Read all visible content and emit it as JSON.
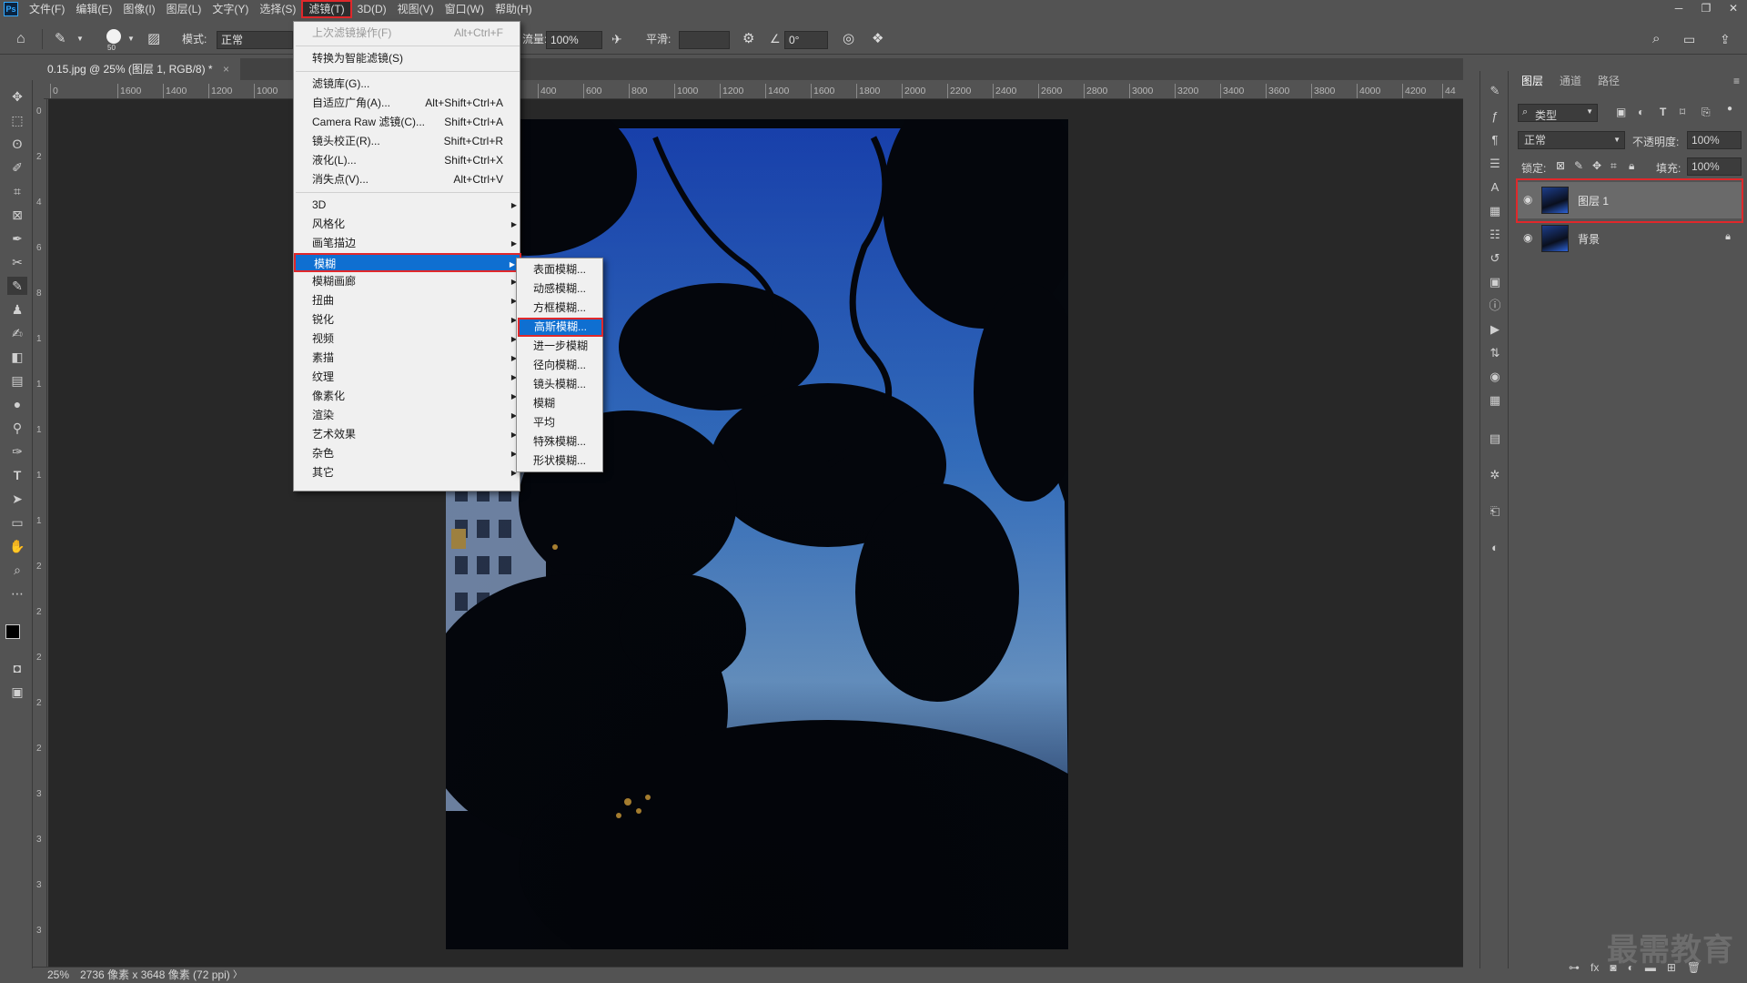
{
  "app": {
    "logo": "Ps"
  },
  "menubar": {
    "items": [
      "文件(F)",
      "编辑(E)",
      "图像(I)",
      "图层(L)",
      "文字(Y)",
      "选择(S)",
      "滤镜(T)",
      "3D(D)",
      "视图(V)",
      "窗口(W)",
      "帮助(H)"
    ],
    "active_index": 6
  },
  "window_controls": {
    "minimize": "─",
    "restore": "❐",
    "close": "✕"
  },
  "options_bar": {
    "brush_size": "50",
    "mode_label": "模式:",
    "mode_value": "正常",
    "flow_label": "流量:",
    "flow_value": "100%",
    "smoothing_label": "平滑:",
    "smoothing_value": "",
    "angle_value": "0°"
  },
  "document_tab": {
    "title": "0.15.jpg @ 25% (图层 1, RGB/8) *",
    "close": "×"
  },
  "ruler_top": [
    "0",
    "1600",
    "1400",
    "1200",
    "1000",
    "800",
    "400",
    "600",
    "800",
    "1000",
    "1200",
    "1400",
    "1600",
    "1800",
    "2000",
    "2200",
    "2400",
    "2600",
    "2800",
    "3000",
    "3200",
    "3400",
    "3600",
    "3800",
    "4000",
    "4200",
    "44"
  ],
  "ruler_left": [
    "0",
    "2",
    "4",
    "6",
    "8",
    "1",
    "1",
    "1",
    "1",
    "1",
    "2",
    "2",
    "2",
    "2",
    "2",
    "3",
    "3",
    "3",
    "3"
  ],
  "filter_menu": {
    "items": [
      {
        "label": "上次滤镜操作(F)",
        "shortcut": "Alt+Ctrl+F",
        "disabled": true
      },
      {
        "sep": true
      },
      {
        "label": "转换为智能滤镜(S)",
        "shortcut": ""
      },
      {
        "sep": true
      },
      {
        "label": "滤镜库(G)...",
        "shortcut": ""
      },
      {
        "label": "自适应广角(A)...",
        "shortcut": "Alt+Shift+Ctrl+A"
      },
      {
        "label": "Camera Raw 滤镜(C)...",
        "shortcut": "Shift+Ctrl+A"
      },
      {
        "label": "镜头校正(R)...",
        "shortcut": "Shift+Ctrl+R"
      },
      {
        "label": "液化(L)...",
        "shortcut": "Shift+Ctrl+X"
      },
      {
        "label": "消失点(V)...",
        "shortcut": "Alt+Ctrl+V"
      },
      {
        "sep": true
      },
      {
        "label": "3D",
        "submenu": true
      },
      {
        "label": "风格化",
        "submenu": true
      },
      {
        "label": "画笔描边",
        "submenu": true
      },
      {
        "label": "模糊",
        "submenu": true,
        "highlighted": true
      },
      {
        "label": "模糊画廊",
        "submenu": true
      },
      {
        "label": "扭曲",
        "submenu": true
      },
      {
        "label": "锐化",
        "submenu": true
      },
      {
        "label": "视频",
        "submenu": true
      },
      {
        "label": "素描",
        "submenu": true
      },
      {
        "label": "纹理",
        "submenu": true
      },
      {
        "label": "像素化",
        "submenu": true
      },
      {
        "label": "渲染",
        "submenu": true
      },
      {
        "label": "艺术效果",
        "submenu": true
      },
      {
        "label": "杂色",
        "submenu": true
      },
      {
        "label": "其它",
        "submenu": true
      }
    ]
  },
  "blur_submenu": {
    "items": [
      "表面模糊...",
      "动感模糊...",
      "方框模糊...",
      "高斯模糊...",
      "进一步模糊",
      "径向模糊...",
      "镜头模糊...",
      "模糊",
      "平均",
      "特殊模糊...",
      "形状模糊..."
    ],
    "highlighted_index": 3
  },
  "status_bar": {
    "zoom": "25%",
    "info": "2736 像素 x 3648 像素 (72 ppi)",
    "arrow": "〉"
  },
  "layers_panel": {
    "tabs": [
      "图层",
      "通道",
      "路径"
    ],
    "active_tab": 0,
    "filter_label": "类型",
    "blend_mode": "正常",
    "opacity_label": "不透明度:",
    "opacity_value": "100%",
    "lock_label": "锁定:",
    "fill_label": "填充:",
    "fill_value": "100%",
    "layers": [
      {
        "name": "图层 1",
        "selected": true,
        "locked": false
      },
      {
        "name": "背景",
        "selected": false,
        "locked": true
      }
    ]
  },
  "watermark": "最需教育",
  "colors": {
    "highlight": "#0f6fd1",
    "annotation_red": "#e0282b",
    "ui_bg": "#535353",
    "canvas_bg": "#282828"
  }
}
